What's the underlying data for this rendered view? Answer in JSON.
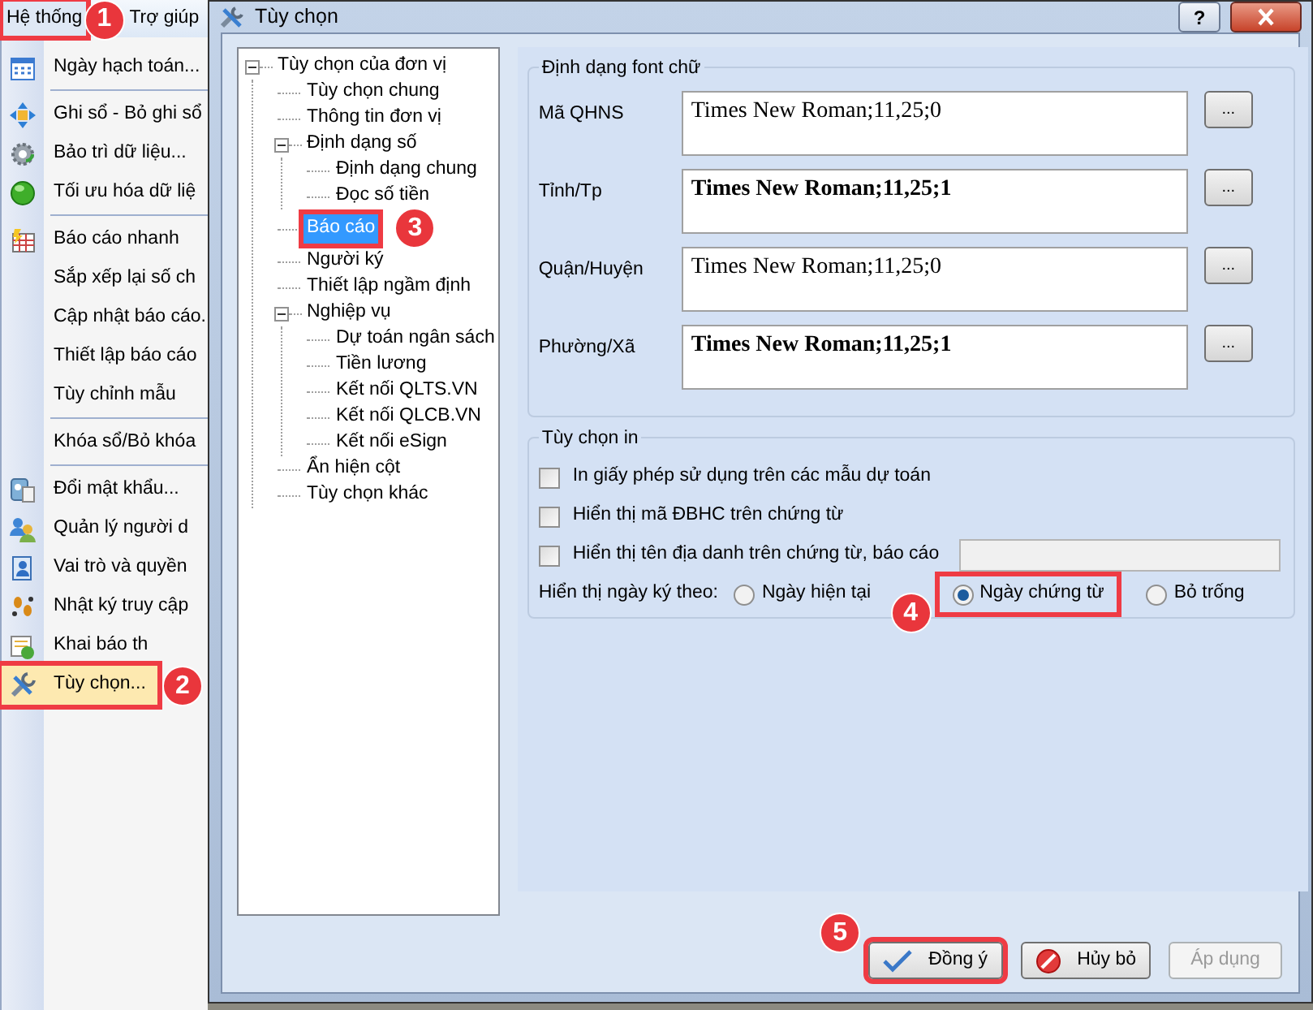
{
  "menubar": [
    {
      "label": "Hệ thống",
      "selected": true,
      "highlighted": true,
      "callout": "1"
    },
    {
      "label": "Trợ giúp",
      "selected": false,
      "highlighted": false
    }
  ],
  "menu": [
    {
      "kind": "item",
      "label": "Ngày hạch toán..."
    },
    {
      "kind": "separator"
    },
    {
      "kind": "item",
      "label": "Ghi sổ - Bỏ ghi sổ"
    },
    {
      "kind": "item",
      "label": "Bảo trì dữ liệu..."
    },
    {
      "kind": "item",
      "label": "Tối ưu hóa dữ liệ"
    },
    {
      "kind": "separator"
    },
    {
      "kind": "item",
      "label": "Báo cáo nhanh"
    },
    {
      "kind": "item",
      "label": "Sắp xếp lại số ch"
    },
    {
      "kind": "item",
      "label": "Cập nhật báo cáo."
    },
    {
      "kind": "item",
      "label": "Thiết lập báo cáo"
    },
    {
      "kind": "item",
      "label": "Tùy chỉnh mẫu"
    },
    {
      "kind": "separator"
    },
    {
      "kind": "item",
      "label": "Khóa sổ/Bỏ khóa"
    },
    {
      "kind": "separator"
    },
    {
      "kind": "item",
      "label": "Đổi mật khẩu..."
    },
    {
      "kind": "item",
      "label": "Quản lý người d"
    },
    {
      "kind": "item",
      "label": "Vai trò và quyền"
    },
    {
      "kind": "item",
      "label": "Nhật ký truy cập"
    },
    {
      "kind": "item",
      "label": "Khai báo th"
    },
    {
      "kind": "item",
      "label": "Tùy chọn...",
      "selected": true,
      "highlighted": true,
      "callout": "2"
    }
  ],
  "dialog": {
    "title": "Tùy chọn",
    "help": "?",
    "tree": [
      {
        "label": "Tùy chọn của đơn vị",
        "expanded": true,
        "selected": false,
        "children": [
          {
            "label": "Tùy chọn chung",
            "selected": false
          },
          {
            "label": "Thông tin đơn vị",
            "selected": false
          },
          {
            "label": "Định dạng số",
            "expanded": true,
            "selected": false,
            "children": [
              {
                "label": "Định dạng chung",
                "selected": false
              },
              {
                "label": "Đọc số tiền",
                "selected": false
              }
            ]
          },
          {
            "label": "Báo cáo",
            "selected": true,
            "highlighted": true,
            "callout": "3"
          },
          {
            "label": "Người ký",
            "selected": false
          },
          {
            "label": "Thiết lập ngầm định",
            "selected": false
          },
          {
            "label": "Nghiệp vụ",
            "expanded": true,
            "selected": false,
            "children": [
              {
                "label": "Dự toán ngân sách",
                "selected": false
              },
              {
                "label": "Tiền lương",
                "selected": false
              },
              {
                "label": "Kết nối QLTS.VN",
                "selected": false
              },
              {
                "label": "Kết nối QLCB.VN",
                "selected": false
              },
              {
                "label": "Kết nối eSign",
                "selected": false
              }
            ]
          },
          {
            "label": "Ẩn hiện cột",
            "selected": false
          },
          {
            "label": "Tùy chọn khác",
            "selected": false
          }
        ]
      }
    ],
    "font_group": {
      "title": "Định dạng font chữ",
      "rows": [
        {
          "label": "Mã QHNS",
          "value": "Times New Roman;11,25;0",
          "bold": false,
          "button": "..."
        },
        {
          "label": "Tỉnh/Tp",
          "value": "Times New Roman;11,25;1",
          "bold": true,
          "button": "..."
        },
        {
          "label": "Quận/Huyện",
          "value": "Times New Roman;11,25;0",
          "bold": false,
          "button": "..."
        },
        {
          "label": "Phường/Xã",
          "value": "Times New Roman;11,25;1",
          "bold": true,
          "button": "..."
        }
      ]
    },
    "print_group": {
      "title": "Tùy chọn in",
      "checkboxes": [
        {
          "label": "In giấy phép sử dụng trên các mẫu dự toán",
          "checked": false
        },
        {
          "label": "Hiển thị mã ĐBHC trên chứng từ",
          "checked": false
        },
        {
          "label": "Hiển thị tên địa danh trên chứng từ, báo cáo",
          "checked": false,
          "has_field": true
        }
      ],
      "date_label": "Hiển thị ngày ký theo:",
      "radios": [
        {
          "label": "Ngày hiện tại",
          "selected": false
        },
        {
          "label": "Ngày chứng từ",
          "selected": true,
          "highlighted": true,
          "callout": "4"
        },
        {
          "label": "Bỏ trống",
          "selected": false
        }
      ]
    },
    "buttons": [
      {
        "kind": "ok",
        "label": "Đồng ý",
        "disabled": false,
        "highlighted": true,
        "callout": "5"
      },
      {
        "kind": "cancel",
        "label": "Hủy bỏ",
        "disabled": false
      },
      {
        "kind": "apply",
        "label": "Áp dụng",
        "disabled": true
      }
    ]
  }
}
